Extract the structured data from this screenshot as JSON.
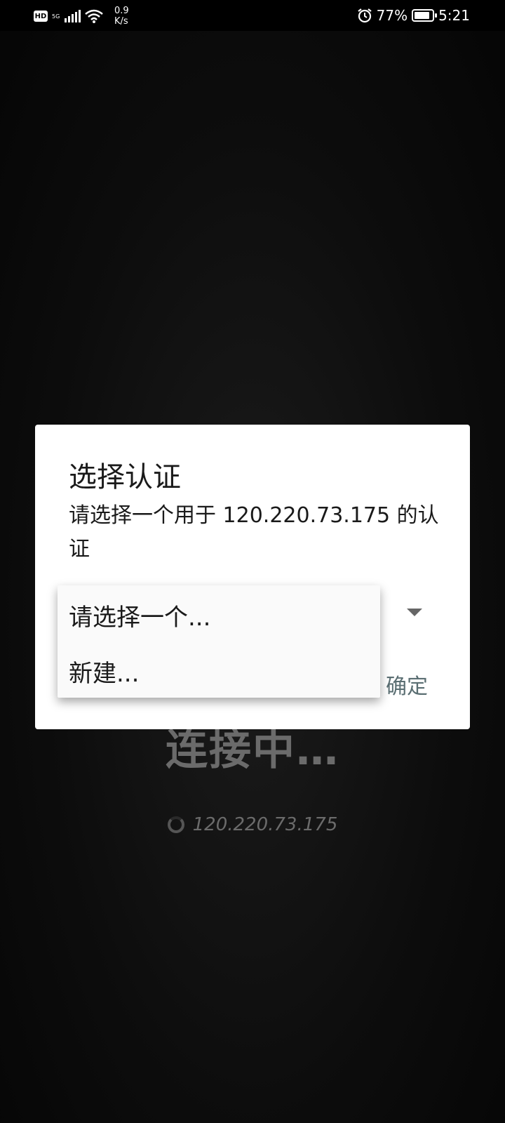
{
  "status_bar": {
    "network_label": "5G",
    "speed_value": "0.9",
    "speed_unit": "K/s",
    "battery": "77%",
    "time": "5:21",
    "icons": [
      "hd-icon",
      "signal-icon",
      "wifi-icon",
      "alarm-icon",
      "battery-icon"
    ]
  },
  "background": {
    "status": "连接中…",
    "host": "120.220.73.175"
  },
  "dialog": {
    "title": "选择认证",
    "message": "请选择一个用于 120.220.73.175 的认证",
    "confirm_label": "确定"
  },
  "dropdown": {
    "options": [
      {
        "label": "请选择一个..."
      },
      {
        "label": "新建..."
      }
    ]
  }
}
